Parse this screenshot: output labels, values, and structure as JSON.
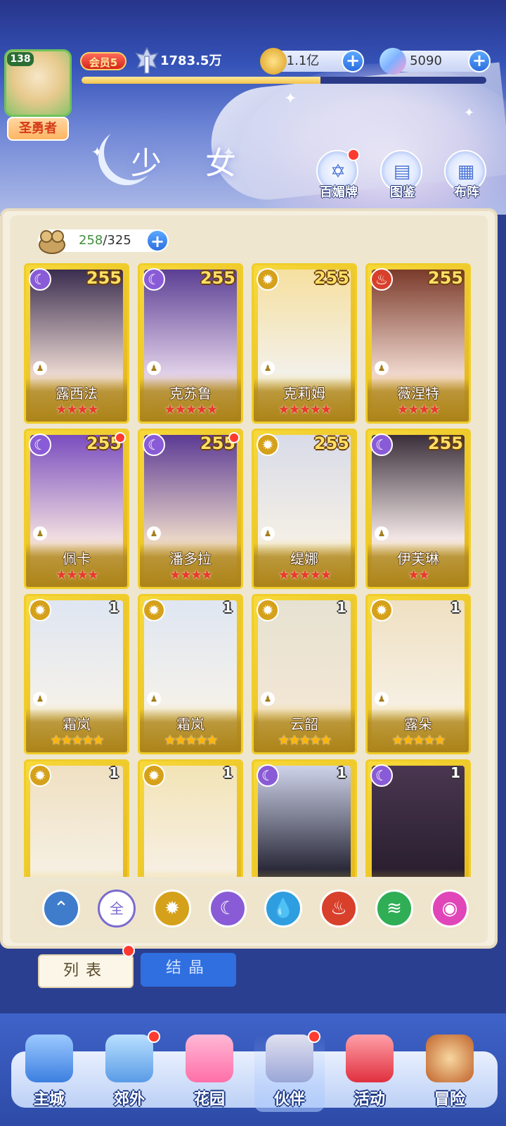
{
  "header": {
    "player_level": "138",
    "player_title": "圣勇者",
    "vip_label": "会员5",
    "power": "1783.5万",
    "exp_progress": 0.59,
    "gold": "1.1亿",
    "gems": "5090",
    "page_title": "少 女",
    "top_buttons": [
      {
        "label": "百媚牌",
        "icon": "card-deck-icon"
      },
      {
        "label": "图鉴",
        "icon": "book-icon"
      },
      {
        "label": "布阵",
        "icon": "grid-formation-icon"
      }
    ]
  },
  "roster": {
    "owned": "258",
    "total": "/325"
  },
  "cards": [
    {
      "name": "露西法",
      "level": "255",
      "element": "moon",
      "stars": "★★★★",
      "star_color": "red",
      "dot": false
    },
    {
      "name": "克苏鲁",
      "level": "255",
      "element": "moon",
      "stars": "★★★★★",
      "star_color": "red",
      "dot": false
    },
    {
      "name": "克莉姆",
      "level": "255",
      "element": "light",
      "stars": "★★★★★",
      "star_color": "red",
      "dot": false
    },
    {
      "name": "薇涅特",
      "level": "255",
      "element": "fire",
      "stars": "★★★★",
      "star_color": "red",
      "dot": false
    },
    {
      "name": "佩卡",
      "level": "255",
      "element": "moon",
      "stars": "★★★★",
      "star_color": "red",
      "dot": true
    },
    {
      "name": "潘多拉",
      "level": "255",
      "element": "moon",
      "stars": "★★★★",
      "star_color": "red",
      "dot": true
    },
    {
      "name": "缇娜",
      "level": "255",
      "element": "light",
      "stars": "★★★★★",
      "star_color": "red",
      "dot": false
    },
    {
      "name": "伊芙琳",
      "level": "255",
      "element": "moon",
      "stars": "★★",
      "star_color": "red",
      "dot": false
    },
    {
      "name": "霜岚",
      "level": "1",
      "element": "light",
      "stars": "★★★★★",
      "star_color": "gold",
      "dot": false
    },
    {
      "name": "霜岚",
      "level": "1",
      "element": "light",
      "stars": "★★★★★",
      "star_color": "gold",
      "dot": false
    },
    {
      "name": "云韶",
      "level": "1",
      "element": "light",
      "stars": "★★★★★",
      "star_color": "gold",
      "dot": false
    },
    {
      "name": "露朵",
      "level": "1",
      "element": "light",
      "stars": "★★★★★",
      "star_color": "gold",
      "dot": false
    },
    {
      "name": "",
      "level": "1",
      "element": "light",
      "stars": "",
      "star_color": "gold",
      "dot": false
    },
    {
      "name": "",
      "level": "1",
      "element": "light",
      "stars": "",
      "star_color": "gold",
      "dot": false
    },
    {
      "name": "",
      "level": "1",
      "element": "moon",
      "stars": "",
      "star_color": "gold",
      "dot": false
    },
    {
      "name": "",
      "level": "1",
      "element": "moon",
      "stars": "",
      "star_color": "gold",
      "dot": false
    }
  ],
  "filters": [
    {
      "label": "",
      "icon": "collapse-arrow-icon"
    },
    {
      "label": "全",
      "icon": "all-filter-icon"
    },
    {
      "label": "",
      "icon": "light-element-icon"
    },
    {
      "label": "",
      "icon": "moon-element-icon"
    },
    {
      "label": "",
      "icon": "water-element-icon"
    },
    {
      "label": "",
      "icon": "fire-element-icon"
    },
    {
      "label": "",
      "icon": "wind-element-icon"
    },
    {
      "label": "",
      "icon": "spirit-element-icon"
    }
  ],
  "tabs": [
    {
      "label": "列表",
      "active": true,
      "dot": true
    },
    {
      "label": "结晶",
      "active": false,
      "dot": false
    }
  ],
  "nav": [
    {
      "label": "主城",
      "icon": "castle-icon",
      "dot": false
    },
    {
      "label": "郊外",
      "icon": "magic-circle-icon",
      "dot": true
    },
    {
      "label": "花园",
      "icon": "heart-garden-icon",
      "dot": false
    },
    {
      "label": "伙伴",
      "icon": "partner-portrait-icon",
      "dot": true
    },
    {
      "label": "活动",
      "icon": "gift-box-icon",
      "dot": false
    },
    {
      "label": "冒险",
      "icon": "compass-sword-icon",
      "dot": false
    }
  ],
  "colors": {
    "moon": "#8a5bd6",
    "light": "#d6a11a",
    "fire": "#d8402c",
    "water": "#2f9ee0",
    "wind": "#2fae55",
    "spirit": "#e046b8",
    "collapse": "#3f7dcc",
    "all": "#7a6bd0"
  }
}
